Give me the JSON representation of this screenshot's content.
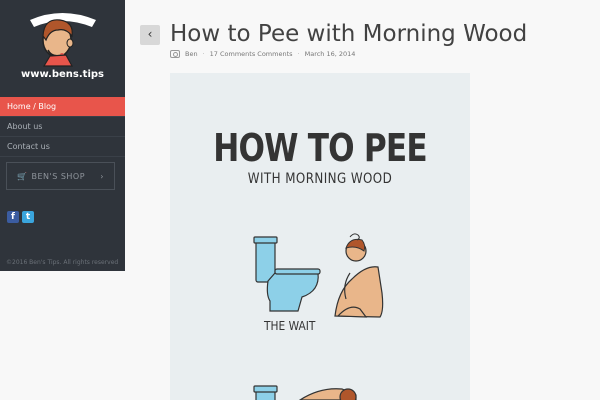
{
  "site": {
    "logo_title": "BEN'S TIPS",
    "logo_url": "www.bens.tips"
  },
  "nav": {
    "items": [
      {
        "label": "Home / Blog",
        "active": true
      },
      {
        "label": "About us",
        "active": false
      },
      {
        "label": "Contact us",
        "active": false
      }
    ]
  },
  "shop": {
    "label": "BEN'S SHOP"
  },
  "social": {
    "facebook": "f",
    "twitter": "t"
  },
  "footer": {
    "copyright": "©2016 Ben's Tips. All rights reserved"
  },
  "post": {
    "title": "How to Pee with Morning Wood",
    "author": "Ben",
    "comments": "17 Comments  Comments",
    "date": "March 16, 2014"
  },
  "infographic": {
    "heading": "HOW TO PEE",
    "subheading": "WITH MORNING WOOD",
    "step1_label": "THE WAIT"
  },
  "colors": {
    "sidebar": "#2f343b",
    "accent": "#e8554b",
    "toilet": "#8dd0e8",
    "skin": "#e9b68a",
    "hair": "#b0562b"
  },
  "icons": {
    "back": "chevron-left-icon",
    "camera": "camera-icon",
    "cart": "cart-icon"
  }
}
